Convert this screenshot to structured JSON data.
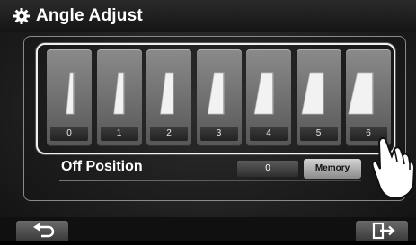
{
  "header": {
    "title": "Angle Adjust"
  },
  "angle_options": [
    {
      "number": "0",
      "level": 0
    },
    {
      "number": "1",
      "level": 1
    },
    {
      "number": "2",
      "level": 2
    },
    {
      "number": "3",
      "level": 3
    },
    {
      "number": "4",
      "level": 4
    },
    {
      "number": "5",
      "level": 5
    },
    {
      "number": "6",
      "level": 6
    }
  ],
  "off_position": {
    "label": "Off Position",
    "value": "0",
    "memory_label": "Memory"
  },
  "icons": {
    "settings": "gear-icon",
    "back": "back-arrow-icon",
    "exit": "exit-icon",
    "pointer": "hand-pointer-icon"
  }
}
